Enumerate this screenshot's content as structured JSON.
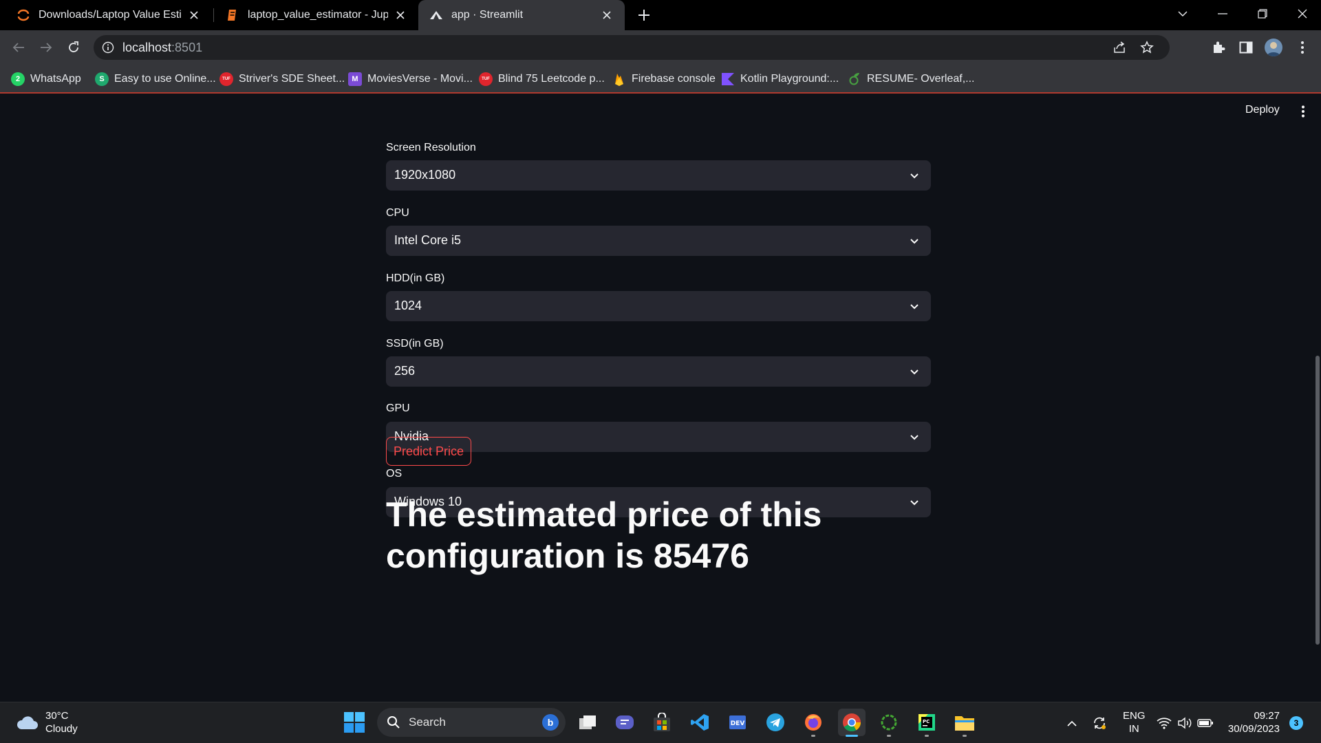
{
  "browser": {
    "tabs": [
      {
        "title": "Downloads/Laptop Value Estima",
        "active": false,
        "icon": "jupyter-icon"
      },
      {
        "title": "laptop_value_estimator - Jupyter",
        "active": false,
        "icon": "notebook-icon"
      },
      {
        "title": "app · Streamlit",
        "active": true,
        "icon": "streamlit-icon"
      }
    ],
    "url_host": "localhost",
    "url_port": ":8501",
    "bookmarks": [
      {
        "label": "WhatsApp",
        "icon": "whatsapp-icon",
        "color": "#25d366",
        "glyph": "2"
      },
      {
        "label": "Easy to use Online...",
        "icon": "s-logo-icon",
        "color": "#1fa96e",
        "glyph": "S"
      },
      {
        "label": "Striver's SDE Sheet...",
        "icon": "tuf-icon",
        "color": "#e0252d",
        "glyph": "TUF"
      },
      {
        "label": "MoviesVerse - Movi...",
        "icon": "moviesverse-icon",
        "color": "#7b4bd6",
        "glyph": "M"
      },
      {
        "label": "Blind 75 Leetcode p...",
        "icon": "tuf-icon",
        "color": "#e0252d",
        "glyph": "TUF"
      },
      {
        "label": "Firebase console",
        "icon": "firebase-icon",
        "color": "#ffa000",
        "glyph": ""
      },
      {
        "label": "Kotlin Playground:...",
        "icon": "kotlin-icon",
        "color": "#7f52ff",
        "glyph": ""
      },
      {
        "label": "RESUME- Overleaf,...",
        "icon": "overleaf-icon",
        "color": "#47a141",
        "glyph": ""
      }
    ]
  },
  "app": {
    "deploy_label": "Deploy",
    "fields": [
      {
        "label": "Screen Resolution",
        "value": "1920x1080"
      },
      {
        "label": "CPU",
        "value": "Intel Core i5"
      },
      {
        "label": "HDD(in GB)",
        "value": "1024"
      },
      {
        "label": "SSD(in GB)",
        "value": "256"
      },
      {
        "label": "GPU",
        "value": "Nvidia"
      },
      {
        "label": "OS",
        "value": "Windows 10"
      }
    ],
    "predict_label": "Predict Price",
    "result_line1": "The estimated price of this",
    "result_line2": "configuration is 85476",
    "accent_color": "#ff4b4b"
  },
  "taskbar": {
    "temperature": "30°C",
    "condition": "Cloudy",
    "search_placeholder": "Search",
    "lang_line1": "ENG",
    "lang_line2": "IN",
    "time": "09:27",
    "date": "30/09/2023",
    "notification_count": "3"
  }
}
